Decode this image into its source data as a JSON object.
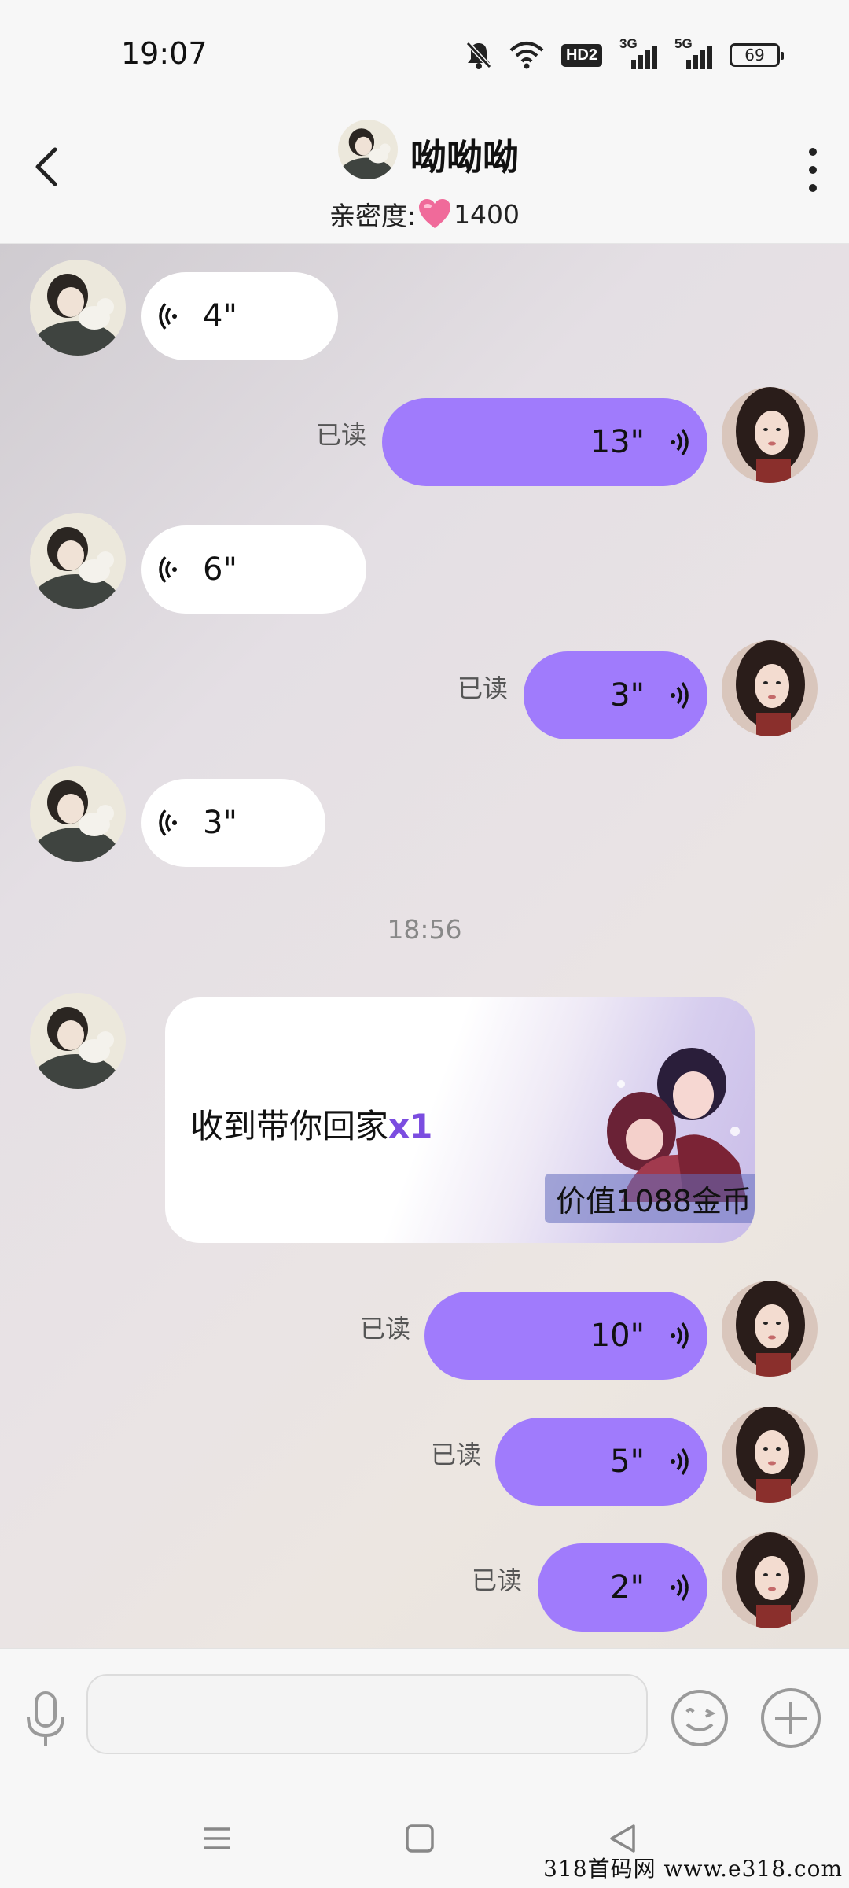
{
  "status_bar": {
    "time": "19:07",
    "net1_label": "3G",
    "net2_label": "5G",
    "hd_label": "HD2",
    "battery": "69",
    "icons": [
      "bell-off-icon",
      "wifi-icon",
      "hd-icon",
      "signal-icon",
      "signal-icon",
      "battery-icon"
    ]
  },
  "header": {
    "contact_name": "呦呦呦",
    "intimacy_label": "亲密度:",
    "intimacy_value": "1400",
    "icons": [
      "back-icon",
      "heart-icon",
      "more-icon"
    ]
  },
  "messages": [
    {
      "side": "in",
      "duration": "4\""
    },
    {
      "side": "out",
      "duration": "13\"",
      "status": "已读"
    },
    {
      "side": "in",
      "duration": "6\""
    },
    {
      "side": "out",
      "duration": "3\"",
      "status": "已读"
    },
    {
      "side": "in",
      "duration": "3\""
    }
  ],
  "time_divider": "18:56",
  "gift": {
    "text": "收到带你回家",
    "qty": "x1",
    "value": "价值1088金币"
  },
  "messages_after": [
    {
      "side": "out",
      "duration": "10\"",
      "status": "已读"
    },
    {
      "side": "out",
      "duration": "5\"",
      "status": "已读"
    },
    {
      "side": "out",
      "duration": "2\"",
      "status": "已读"
    }
  ],
  "input_bar": {
    "placeholder": "",
    "icons": [
      "microphone-icon",
      "emoji-icon",
      "plus-icon"
    ]
  },
  "nav_bar": {
    "icons": [
      "menu-icon",
      "home-square-icon",
      "back-triangle-icon"
    ]
  },
  "watermark": "318首码网  www.e318.com",
  "colors": {
    "accent_bubble": "#a07bfc",
    "incoming_bubble": "#ffffff",
    "heart": "#f06a9a"
  }
}
